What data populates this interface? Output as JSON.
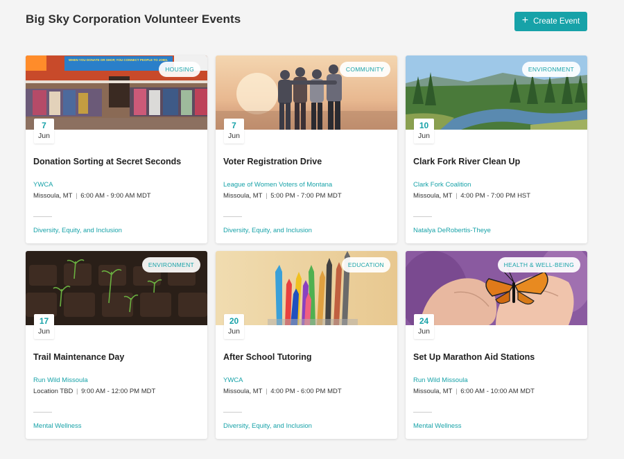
{
  "header": {
    "title": "Big Sky Corporation Volunteer Events",
    "create_button_label": "Create Event",
    "create_icon": "+"
  },
  "colors": {
    "accent": "#17a2a8",
    "background": "#f4f4f4"
  },
  "events": [
    {
      "tag": "HOUSING",
      "day": "7",
      "month": "Jun",
      "title": "Donation Sorting at Secret Seconds",
      "org": "YWCA",
      "location": "Missoula, MT",
      "time": "6:00 AM - 9:00 AM MDT",
      "cause": "Diversity, Equity, and Inclusion",
      "image": "thrift-store-photo",
      "sign_text": "WHEN YOU DONATE OR SHOP, YOU CONNECT PEOPLE TO JOBS."
    },
    {
      "tag": "COMMUNITY",
      "day": "7",
      "month": "Jun",
      "title": "Voter Registration Drive",
      "org": "League of Women Voters of Montana",
      "location": "Missoula, MT",
      "time": "5:00 PM - 7:00 PM MDT",
      "cause": "Diversity, Equity, and Inclusion",
      "image": "friends-sunset-photo"
    },
    {
      "tag": "ENVIRONMENT",
      "day": "10",
      "month": "Jun",
      "title": "Clark Fork River Clean Up",
      "org": "Clark Fork Coalition",
      "location": "Missoula, MT",
      "time": "4:00 PM - 7:00 PM HST",
      "cause": "Natalya DeRobertis-Theye",
      "image": "river-landscape-photo"
    },
    {
      "tag": "ENVIRONMENT",
      "day": "17",
      "month": "Jun",
      "title": "Trail Maintenance Day",
      "org": "Run Wild Missoula",
      "location": "Location TBD",
      "time": "9:00 AM - 12:00 PM MDT",
      "cause": "Mental Wellness",
      "image": "seedlings-photo"
    },
    {
      "tag": "EDUCATION",
      "day": "20",
      "month": "Jun",
      "title": "After School Tutoring",
      "org": "YWCA",
      "location": "Missoula, MT",
      "time": "4:00 PM - 6:00 PM MDT",
      "cause": "Diversity, Equity, and Inclusion",
      "image": "colored-pencils-photo"
    },
    {
      "tag": "HEALTH & WELL-BEING",
      "day": "24",
      "month": "Jun",
      "title": "Set Up Marathon Aid Stations",
      "org": "Run Wild Missoula",
      "location": "Missoula, MT",
      "time": "6:00 AM - 10:00 AM MDT",
      "cause": "Mental Wellness",
      "image": "butterfly-hands-photo"
    }
  ]
}
